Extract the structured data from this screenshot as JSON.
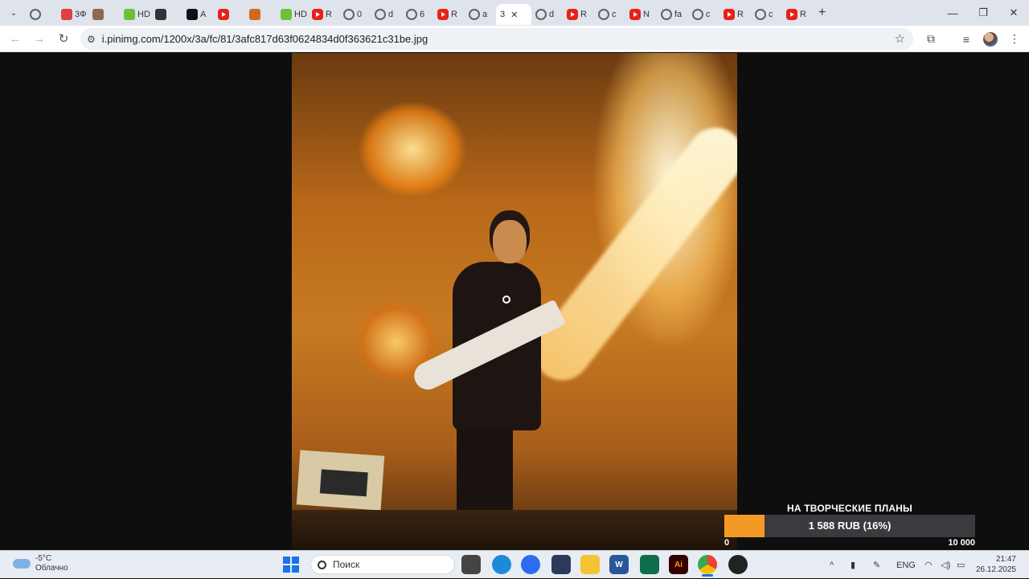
{
  "browser": {
    "tabs": [
      {
        "icon": "globe-icon",
        "label": ""
      },
      {
        "icon": "site-3d-icon",
        "label": "3Ф"
      },
      {
        "icon": "avatar-icon",
        "label": ""
      },
      {
        "icon": "hd-icon",
        "label": "HD"
      },
      {
        "icon": "kinopoisk-icon",
        "label": ""
      },
      {
        "icon": "a-logo-icon",
        "label": "A"
      },
      {
        "icon": "youtube-icon",
        "label": ""
      },
      {
        "icon": "hd-orange-icon",
        "label": ""
      },
      {
        "icon": "hd-green-icon",
        "label": "HD"
      },
      {
        "icon": "youtube-icon",
        "label": "R"
      },
      {
        "icon": "globe-icon",
        "label": "0"
      },
      {
        "icon": "globe-icon",
        "label": "d"
      },
      {
        "icon": "globe-icon",
        "label": "6"
      },
      {
        "icon": "youtube-icon",
        "label": "R"
      },
      {
        "icon": "globe-icon",
        "label": "a"
      },
      {
        "icon": "",
        "label": "3",
        "active": true
      },
      {
        "icon": "globe-icon",
        "label": "d"
      },
      {
        "icon": "youtube-icon",
        "label": "R"
      },
      {
        "icon": "globe-icon",
        "label": "c"
      },
      {
        "icon": "youtube-icon",
        "label": "N"
      },
      {
        "icon": "globe-icon",
        "label": "fa"
      },
      {
        "icon": "globe-icon",
        "label": "c"
      },
      {
        "icon": "youtube-icon",
        "label": "R"
      },
      {
        "icon": "globe-icon",
        "label": "c"
      },
      {
        "icon": "youtube-icon",
        "label": "R"
      }
    ],
    "new_tab": "+",
    "url": "i.pinimg.com/1200x/3a/fc/81/3afc817d63f0624834d0f363621c31be.jpg"
  },
  "donation": {
    "title": "НА ТВОРЧЕСКИЕ ПЛАНЫ",
    "amount_text": "1 588 RUB (16%)",
    "progress": 0.16,
    "min_label": "0",
    "max_label": "10 000",
    "fill_color": "#f39a24"
  },
  "taskbar": {
    "weather_temp": "-5°C",
    "weather_desc": "Облачно",
    "search_placeholder": "Поиск",
    "language": "ENG",
    "time": "21:47",
    "date": "26.12.2025"
  }
}
